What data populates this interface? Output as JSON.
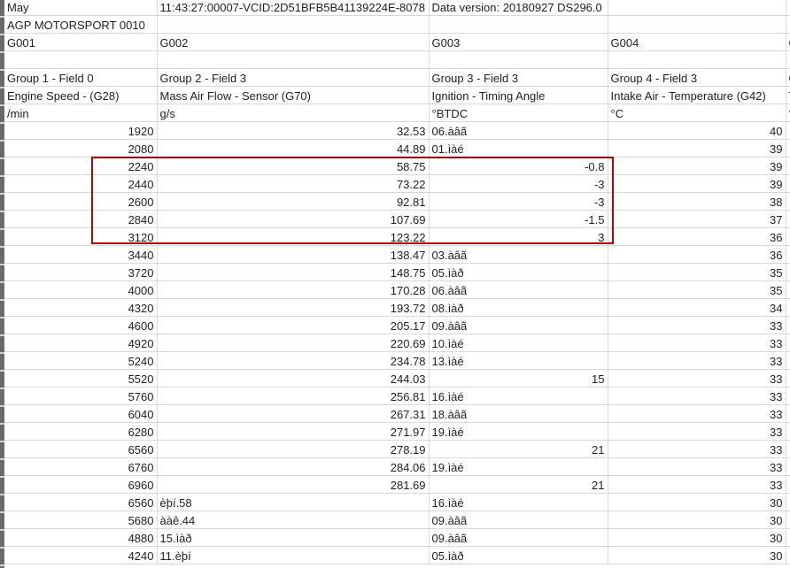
{
  "header_rows": [
    [
      "May",
      "11:43:27:00007-VCID:2D51BFB5B41139224E-8078",
      "Data version: 20180927 DS296.0",
      "",
      ""
    ],
    [
      "AGP MOTORSPORT     0010",
      "",
      "",
      "",
      ""
    ],
    [
      "G001",
      "G002",
      "G003",
      "G004",
      "G"
    ],
    [
      "",
      "",
      "",
      "",
      ""
    ],
    [
      "Group 1 - Field 0",
      "Group 2 - Field 3",
      "Group 3 - Field 3",
      "Group 4 - Field 3",
      "G"
    ],
    [
      "Engine Speed - (G28)",
      "Mass Air Flow - Sensor (G70)",
      "Ignition - Timing Angle",
      "Intake Air - Temperature (G42)",
      "T"
    ],
    [
      " /min",
      "g/s",
      "°BTDC",
      "°C",
      "°"
    ]
  ],
  "data_rows": [
    [
      "1920",
      "32.53",
      "06.àâã",
      "40"
    ],
    [
      "2080",
      "44.89",
      "01.ìàé",
      "39"
    ],
    [
      "2240",
      "58.75",
      "-0.8",
      "39"
    ],
    [
      "2440",
      "73.22",
      "-3",
      "39"
    ],
    [
      "2600",
      "92.81",
      "-3",
      "38"
    ],
    [
      "2840",
      "107.69",
      "-1.5",
      "37"
    ],
    [
      "3120",
      "123.22",
      "3",
      "36"
    ],
    [
      "3440",
      "138.47",
      "03.àâã",
      "36"
    ],
    [
      "3720",
      "148.75",
      "05.ìàð",
      "35"
    ],
    [
      "4000",
      "170.28",
      "06.àâã",
      "35"
    ],
    [
      "4320",
      "193.72",
      "08.ìàð",
      "34"
    ],
    [
      "4600",
      "205.17",
      "09.àâã",
      "33"
    ],
    [
      "4920",
      "220.69",
      "10.ìàé",
      "33"
    ],
    [
      "5240",
      "234.78",
      "13.ìàé",
      "33"
    ],
    [
      "5520",
      "244.03",
      "15",
      "33"
    ],
    [
      "5760",
      "256.81",
      "16.ìàé",
      "33"
    ],
    [
      "6040",
      "267.31",
      "18.àâã",
      "33"
    ],
    [
      "6280",
      "271.97",
      "19.ìàé",
      "33"
    ],
    [
      "6560",
      "278.19",
      "21",
      "33"
    ],
    [
      "6760",
      "284.06",
      "19.ìàé",
      "33"
    ],
    [
      "6960",
      "281.69",
      "21",
      "33"
    ],
    [
      "6560",
      "èþí.58",
      "16.ìàé",
      "30"
    ],
    [
      "5680",
      "ààê.44",
      "09.àâã",
      "30"
    ],
    [
      "4880",
      "15.ìàð",
      "09.àâã",
      "30"
    ],
    [
      "4240",
      "11.èþí",
      "05.ìàð",
      "30"
    ]
  ],
  "highlight_color": "#c00000"
}
